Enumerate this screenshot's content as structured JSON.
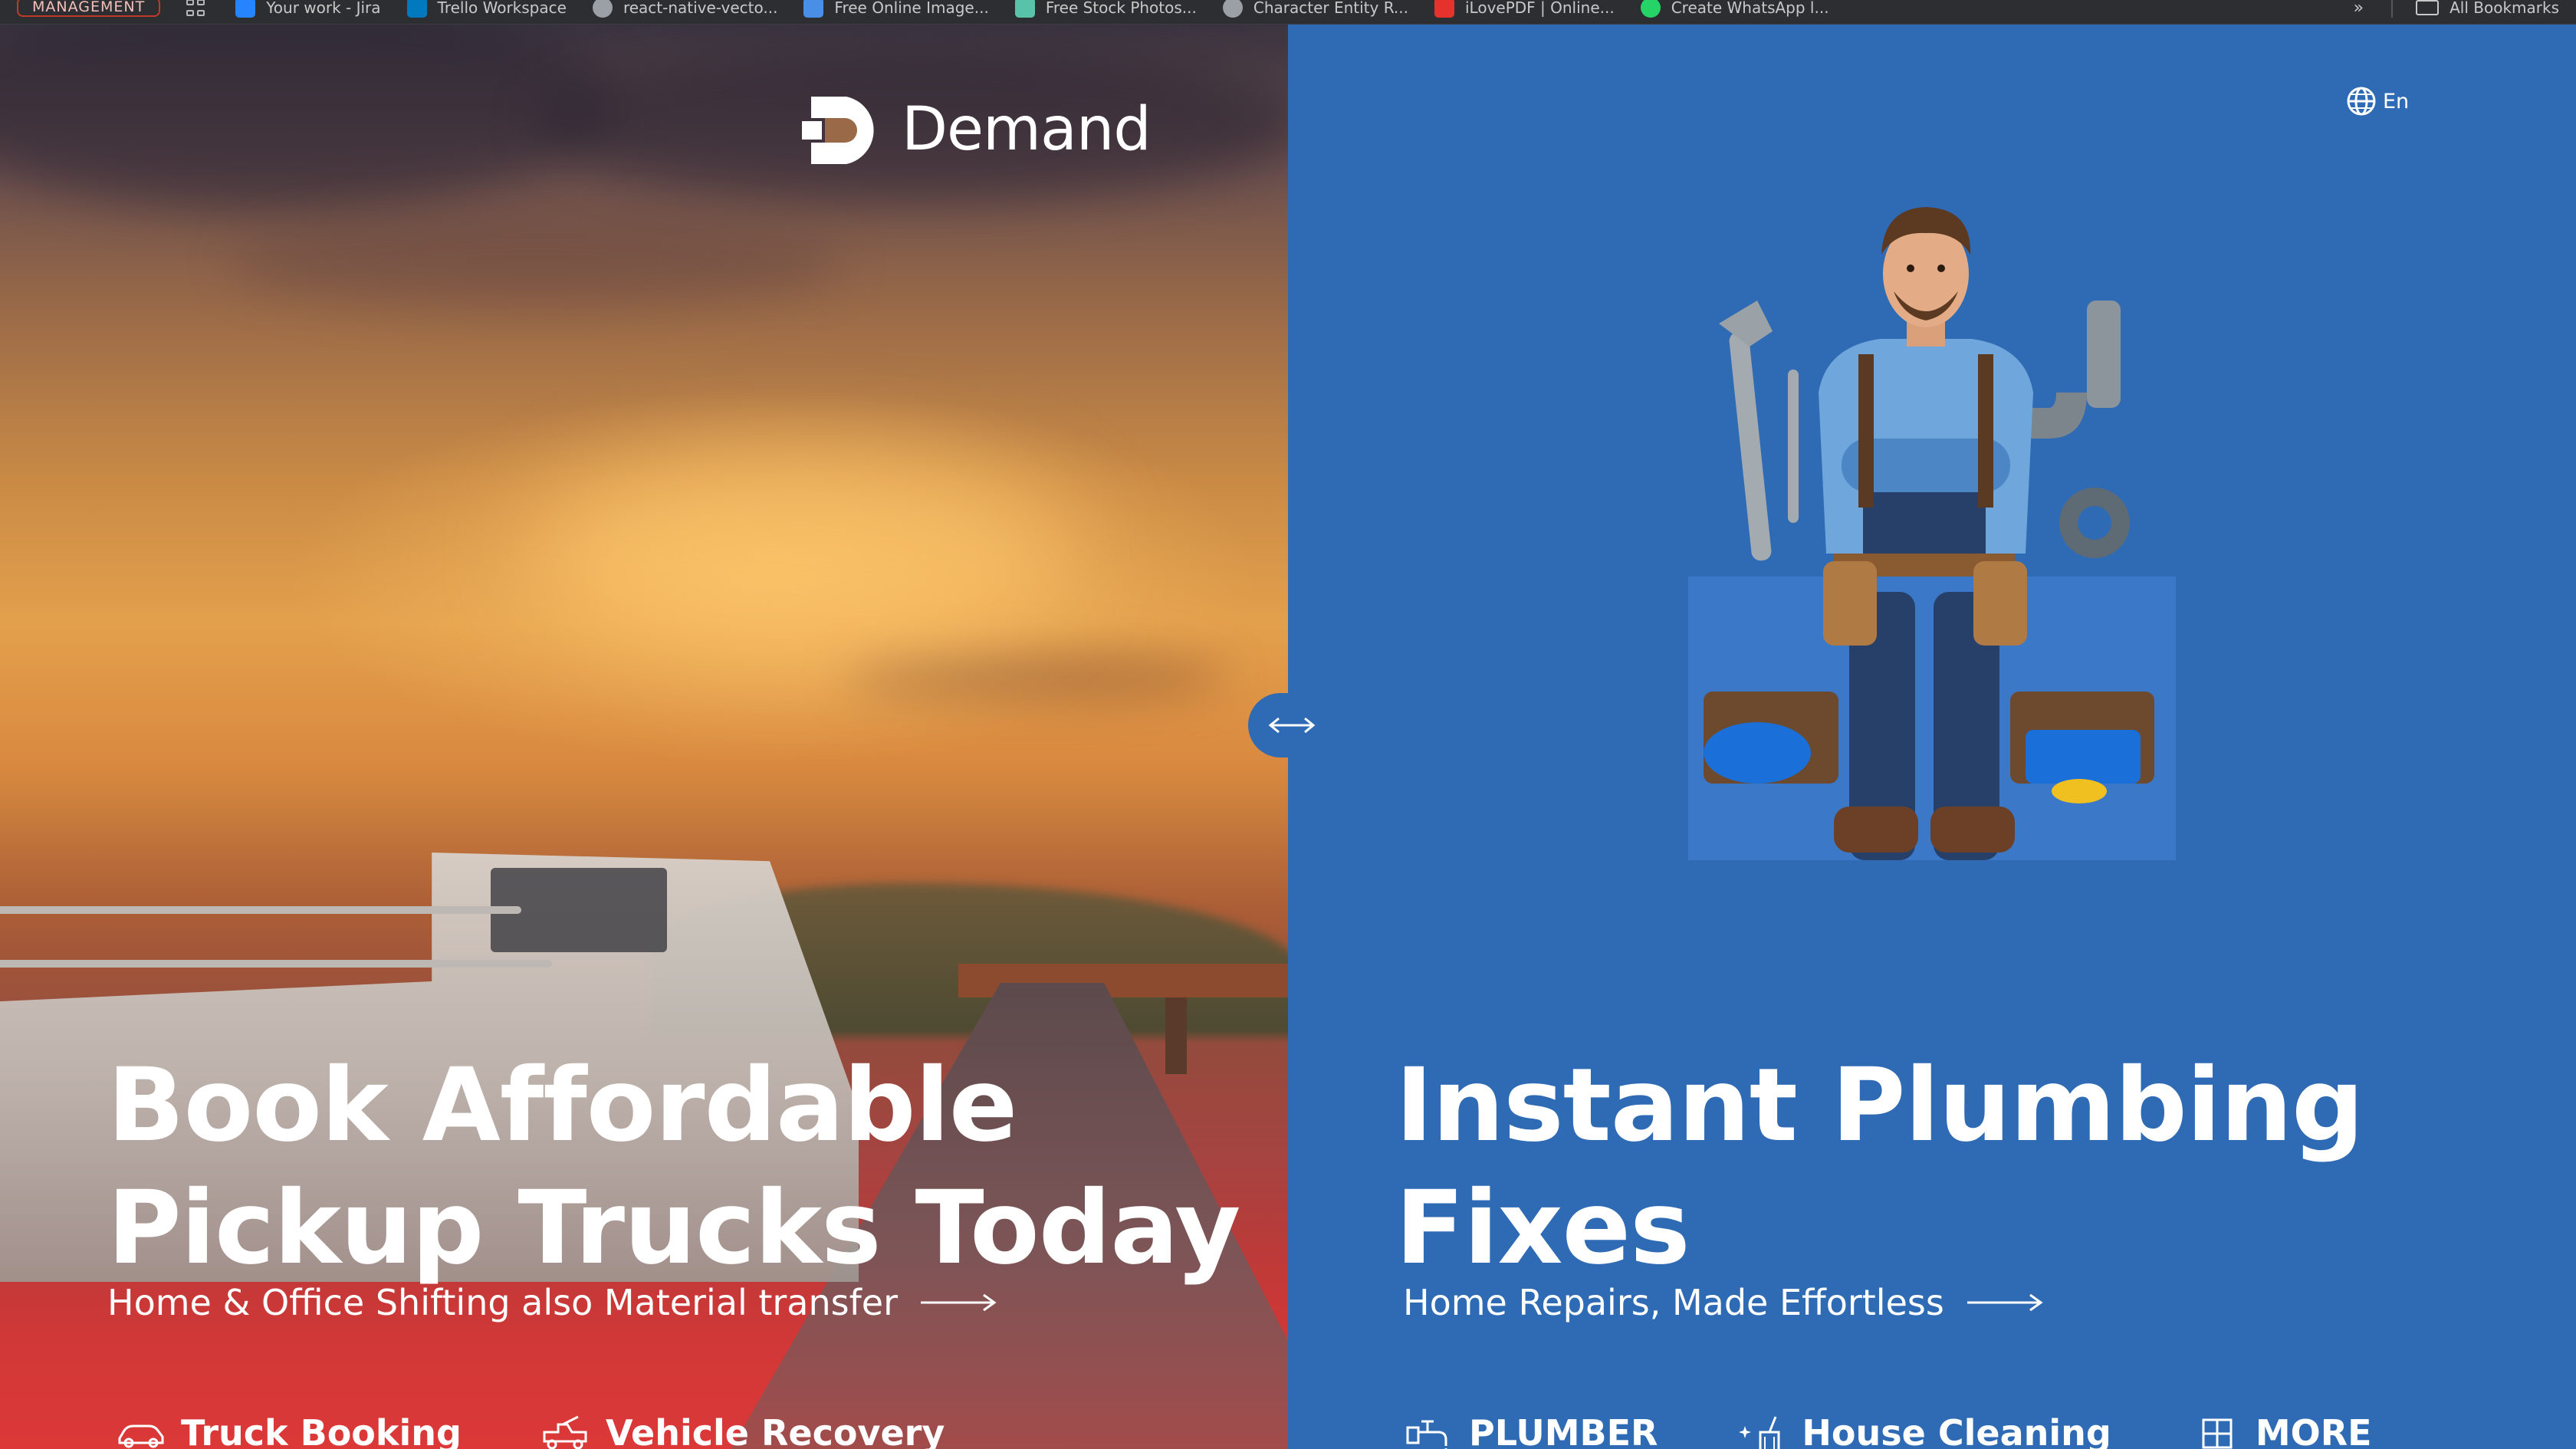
{
  "bookmarks": {
    "management_label": "MANAGEMENT",
    "items": [
      {
        "label": "Your work - Jira",
        "icon": "jira-icon",
        "color": "#2684ff"
      },
      {
        "label": "Trello Workspace",
        "icon": "trello-icon",
        "color": "#0079bf"
      },
      {
        "label": "react-native-vecto...",
        "icon": "globe-icon",
        "color": "#9aa0a6"
      },
      {
        "label": "Free Online Image...",
        "icon": "image-tool-icon",
        "color": "#4a8fe7"
      },
      {
        "label": "Free Stock Photos...",
        "icon": "stock-photo-icon",
        "color": "#58c3a8"
      },
      {
        "label": "Character Entity R...",
        "icon": "globe-icon",
        "color": "#9aa0a6"
      },
      {
        "label": "iLovePDF | Online...",
        "icon": "ilovepdf-icon",
        "color": "#e5322d"
      },
      {
        "label": "Create WhatsApp l...",
        "icon": "whatsapp-icon",
        "color": "#25d366"
      }
    ],
    "overflow_label": "»",
    "all_bookmarks_label": "All Bookmarks"
  },
  "brand": {
    "name": "Demand"
  },
  "language": {
    "label": "En"
  },
  "left_panel": {
    "headline_line1": "Book Affordable",
    "headline_line2": "Pickup Trucks Today",
    "subheading": "Home & Office Shifting also Material transfer",
    "services": [
      {
        "label": "Truck Booking",
        "icon": "car-icon"
      },
      {
        "label": "Vehicle Recovery",
        "icon": "tow-truck-icon"
      }
    ],
    "accent_color": "#d64848"
  },
  "right_panel": {
    "headline_line1": "Instant Plumbing",
    "headline_line2": "Fixes",
    "subheading": "Home Repairs, Made Effortless",
    "services": [
      {
        "label": "PLUMBER",
        "icon": "faucet-icon"
      },
      {
        "label": "House Cleaning",
        "icon": "cleaning-icon"
      },
      {
        "label": "MORE",
        "icon": "grid-icon"
      }
    ],
    "background_color": "#2f6bb5"
  }
}
